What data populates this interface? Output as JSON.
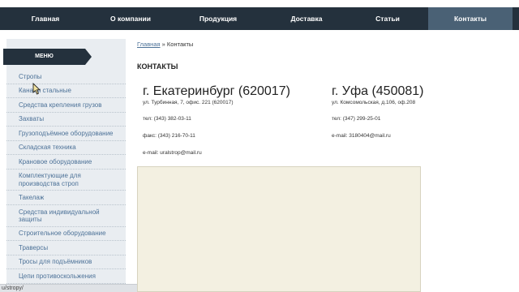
{
  "nav": {
    "items": [
      {
        "label": "Главная"
      },
      {
        "label": "О компании"
      },
      {
        "label": "Продукция"
      },
      {
        "label": "Доставка"
      },
      {
        "label": "Статьи"
      },
      {
        "label": "Контакты"
      }
    ]
  },
  "sidebar": {
    "menu_title": "МЕНЮ",
    "items": [
      {
        "label": "Стропы"
      },
      {
        "label": "Канаты стальные"
      },
      {
        "label": "Средства крепления грузов"
      },
      {
        "label": "Захваты"
      },
      {
        "label": "Грузоподъёмное оборудование"
      },
      {
        "label": "Складская техника"
      },
      {
        "label": "Крановое оборудование"
      },
      {
        "label": "Комплектующие для производства строп"
      },
      {
        "label": "Такелаж"
      },
      {
        "label": "Средства индивидуальной защиты"
      },
      {
        "label": "Строительное оборудование"
      },
      {
        "label": "Траверсы"
      },
      {
        "label": "Тросы для подъёмников"
      },
      {
        "label": "Цепи противоскольжения"
      }
    ]
  },
  "breadcrumb": {
    "home": "Главная",
    "separator": "»",
    "current": "Контакты"
  },
  "page_title": "КОНТАКТЫ",
  "contacts": {
    "ekb": {
      "city": "г. Екатеринбург (620017)",
      "address": "ул. Турбинная, 7, офис. 221 (620017)",
      "phone": "тел: (343) 382-03-11",
      "fax": "факс: (343) 216-70-11",
      "email": "e-mail: uralstrop@mail.ru"
    },
    "ufa": {
      "city": "г. Уфа (450081)",
      "address": "ул. Комсомольская, д.106, оф.208",
      "phone": "тел: (347) 299-25-01",
      "email": "e-mail: 3180404@mail.ru"
    }
  },
  "status_url": "u/stropy/",
  "colors": {
    "nav_bg": "#24313d",
    "nav_active": "#4a6175",
    "sidebar_bg": "#e9edf1",
    "link": "#4d7298",
    "map_bg": "#f3f0e1"
  }
}
